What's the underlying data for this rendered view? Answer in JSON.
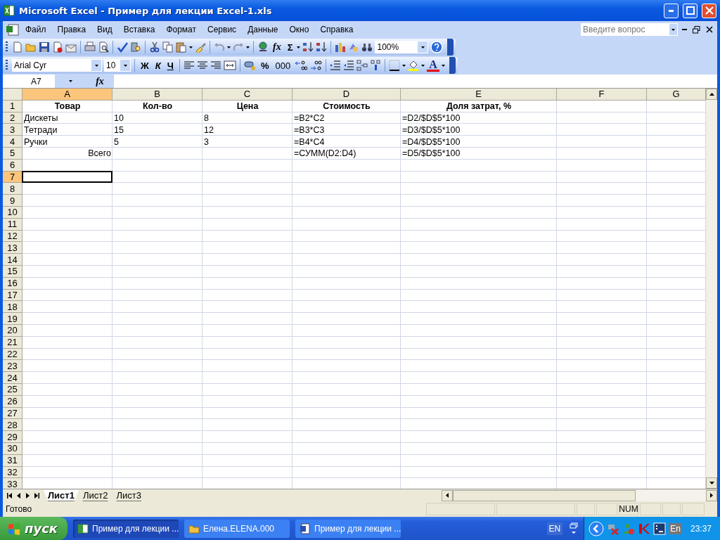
{
  "window": {
    "title": "Microsoft Excel - Пример для лекции Excel-1.xls"
  },
  "menu": [
    "Файл",
    "Правка",
    "Вид",
    "Вставка",
    "Формат",
    "Сервис",
    "Данные",
    "Окно",
    "Справка"
  ],
  "help_box": {
    "placeholder": "Введите вопрос"
  },
  "standard_toolbar": {
    "function_label": "fx",
    "sum_label": "Σ",
    "zoom": "100%"
  },
  "formatting_toolbar": {
    "font": "Arial Cyr",
    "size": "10",
    "bold": "Ж",
    "italic": "К",
    "underline": "Ч",
    "percent": "%",
    "thousands": "000",
    "font_color": "A"
  },
  "formula_bar": {
    "name_box": "A7",
    "function_label": "fx"
  },
  "columns": [
    {
      "label": "A",
      "selected": true
    },
    {
      "label": "B",
      "selected": false
    },
    {
      "label": "C",
      "selected": false
    },
    {
      "label": "D",
      "selected": false
    },
    {
      "label": "E",
      "selected": false
    },
    {
      "label": "F",
      "selected": false
    },
    {
      "label": "G",
      "selected": false
    }
  ],
  "rows": [
    {
      "number": "1",
      "selected": false,
      "kind": "header",
      "cells": [
        "Товар",
        "Кол-во",
        "Цена",
        "Стоимость",
        "Доля затрат, %"
      ]
    },
    {
      "number": "2",
      "selected": false,
      "kind": "data",
      "cells": [
        "Дискеты",
        "10",
        "8",
        "=B2*C2",
        "=D2/$D$5*100"
      ]
    },
    {
      "number": "3",
      "selected": false,
      "kind": "data",
      "cells": [
        "Тетради",
        "15",
        "12",
        "=B3*C3",
        "=D3/$D$5*100"
      ]
    },
    {
      "number": "4",
      "selected": false,
      "kind": "data",
      "cells": [
        "Ручки",
        "5",
        "3",
        "=B4*C4",
        "=D4/$D$5*100"
      ]
    },
    {
      "number": "5",
      "selected": false,
      "kind": "total",
      "cells": [
        "Всего",
        null,
        null,
        "=СУММ(D2:D4)",
        "=D5/$D$5*100"
      ]
    },
    {
      "number": "6",
      "selected": false
    },
    {
      "number": "7",
      "selected": true
    },
    {
      "number": "8",
      "selected": false
    },
    {
      "number": "9",
      "selected": false
    },
    {
      "number": "10",
      "selected": false
    },
    {
      "number": "11",
      "selected": false
    },
    {
      "number": "12",
      "selected": false
    },
    {
      "number": "13",
      "selected": false
    },
    {
      "number": "14",
      "selected": false
    },
    {
      "number": "15",
      "selected": false
    },
    {
      "number": "16",
      "selected": false
    },
    {
      "number": "17",
      "selected": false
    },
    {
      "number": "18",
      "selected": false
    },
    {
      "number": "19",
      "selected": false
    },
    {
      "number": "20",
      "selected": false
    },
    {
      "number": "21",
      "selected": false
    },
    {
      "number": "22",
      "selected": false
    },
    {
      "number": "23",
      "selected": false
    },
    {
      "number": "24",
      "selected": false
    },
    {
      "number": "25",
      "selected": false
    },
    {
      "number": "26",
      "selected": false
    },
    {
      "number": "27",
      "selected": false
    },
    {
      "number": "28",
      "selected": false
    },
    {
      "number": "29",
      "selected": false
    },
    {
      "number": "30",
      "selected": false
    },
    {
      "number": "31",
      "selected": false
    },
    {
      "number": "32",
      "selected": false
    },
    {
      "number": "33",
      "selected": false
    }
  ],
  "sheet_tabs": [
    {
      "label": "Лист1",
      "selected": true
    },
    {
      "label": "Лист2",
      "selected": false
    },
    {
      "label": "Лист3",
      "selected": false
    }
  ],
  "status_bar": {
    "text": "Готово",
    "indicators": [
      "NUM"
    ]
  },
  "taskbar": {
    "start": "пуск",
    "tasks": [
      {
        "label": "Пример для лекции ...",
        "kind": "excel",
        "selected": true
      },
      {
        "label": "Елена.ELENA.000",
        "kind": "folder",
        "selected": false
      },
      {
        "label": "Пример для лекции ...",
        "kind": "word",
        "selected": false
      }
    ],
    "language": "EN",
    "tray_language": "En",
    "clock": "23:37"
  }
}
